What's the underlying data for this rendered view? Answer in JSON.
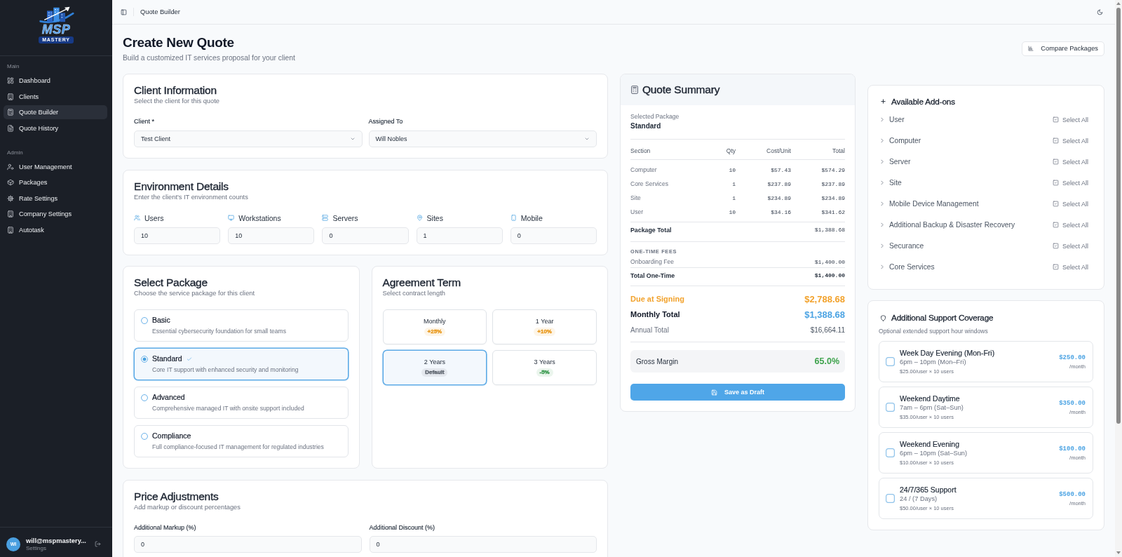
{
  "sidebar": {
    "logo": {
      "wordmark": "MSP",
      "tagline": "MASTERY"
    },
    "sections": [
      {
        "heading": "Main",
        "items": [
          {
            "label": "Dashboard",
            "selected": false
          },
          {
            "label": "Clients",
            "selected": false
          },
          {
            "label": "Quote Builder",
            "selected": true
          },
          {
            "label": "Quote History",
            "selected": false
          }
        ]
      },
      {
        "heading": "Admin",
        "items": [
          {
            "label": "User Management",
            "selected": false
          },
          {
            "label": "Packages",
            "selected": false
          },
          {
            "label": "Rate Settings",
            "selected": false
          },
          {
            "label": "Company Settings",
            "selected": false
          },
          {
            "label": "Autotask",
            "selected": false
          }
        ]
      }
    ],
    "user": {
      "initials": "WI",
      "email": "will@mspmastery...",
      "subtitle": "Settings"
    }
  },
  "top_bar": {
    "title": "Quote Builder"
  },
  "header": {
    "title": "Create New Quote",
    "subtitle": "Build a customized IT services proposal for your client",
    "compare_button": "Compare Packages"
  },
  "client_information": {
    "title": "Client Information",
    "subtitle": "Select the client for this quote",
    "fields": [
      {
        "label": "Client *",
        "value": "Test Client"
      },
      {
        "label": "Assigned To",
        "value": "Will Nobles"
      }
    ]
  },
  "environment_details": {
    "title": "Environment Details",
    "subtitle": "Enter the client's IT environment counts",
    "fields": [
      {
        "label": "Users",
        "value": "10"
      },
      {
        "label": "Workstations",
        "value": "10"
      },
      {
        "label": "Servers",
        "value": "0"
      },
      {
        "label": "Sites",
        "value": "1"
      },
      {
        "label": "Mobile",
        "value": "0"
      }
    ]
  },
  "select_package": {
    "title": "Select Package",
    "subtitle": "Choose the service package for this client",
    "options": [
      {
        "name": "Basic",
        "description": "Essential cybersecurity foundation for small teams",
        "selected": false
      },
      {
        "name": "Standard",
        "description": "Core IT support with enhanced security and monitoring",
        "selected": true
      },
      {
        "name": "Advanced",
        "description": "Comprehensive managed IT with onsite support included",
        "selected": false
      },
      {
        "name": "Compliance",
        "description": "Full compliance-focused IT management for regulated industries",
        "selected": false
      }
    ]
  },
  "agreement_term": {
    "title": "Agreement Term",
    "subtitle": "Select contract length",
    "options": [
      {
        "label": "Monthly",
        "badge": "+25%",
        "color": "#e99a1f",
        "selected": false
      },
      {
        "label": "1 Year",
        "badge": "+10%",
        "color": "#e99a1f",
        "selected": false
      },
      {
        "label": "2 Years",
        "badge": "Default",
        "color": "#5f6670",
        "selected": true
      },
      {
        "label": "3 Years",
        "badge": "-5%",
        "color": "#3a9a4f",
        "selected": false
      }
    ]
  },
  "price_adjustments": {
    "title": "Price Adjustments",
    "subtitle": "Add markup or discount percentages",
    "fields": [
      {
        "label": "Additional Markup (%)",
        "value": "0"
      },
      {
        "label": "Additional Discount (%)",
        "value": "0"
      }
    ]
  },
  "quote_summary": {
    "title": "Quote Summary",
    "selected_package_label": "Selected Package",
    "selected_package": "Standard",
    "columns": [
      "Section",
      "Qty",
      "Cost/Unit",
      "Total"
    ],
    "rows": [
      [
        "Computer",
        "10",
        "$57.43",
        "$574.29"
      ],
      [
        "Core Services",
        "1",
        "$237.89",
        "$237.89"
      ],
      [
        "Site",
        "1",
        "$234.89",
        "$234.89"
      ],
      [
        "User",
        "10",
        "$34.16",
        "$341.62"
      ]
    ],
    "package_total": {
      "label": "Package Total",
      "value": "$1,388.68"
    },
    "one_time_fees": {
      "heading": "ONE-TIME FEES",
      "items": [
        {
          "label": "Onboarding Fee",
          "value": "$1,400.00"
        }
      ],
      "total": {
        "label": "Total One-Time",
        "value": "$1,400.00"
      }
    },
    "totals": [
      {
        "kind": "due",
        "label": "Due at Signing",
        "value": "$2,788.68"
      },
      {
        "kind": "monthly",
        "label": "Monthly Total",
        "value": "$1,388.68"
      },
      {
        "kind": "annual",
        "label": "Annual Total",
        "value": "$16,664.11"
      }
    ],
    "gross_margin": {
      "label": "Gross Margin",
      "value": "65.0%"
    },
    "save_button": "Save as Draft"
  },
  "addons": {
    "title": "Available Add-ons",
    "categories": [
      {
        "name": "User",
        "expanded": false,
        "action": "Select All"
      },
      {
        "name": "Computer",
        "expanded": false,
        "action": "Select All"
      },
      {
        "name": "Server",
        "expanded": false,
        "action": "Select All"
      },
      {
        "name": "Site",
        "expanded": false,
        "action": "Select All"
      },
      {
        "name": "Mobile Device Management",
        "expanded": false,
        "action": "Select All"
      },
      {
        "name": "Additional Backup & Disaster Recovery",
        "expanded": false,
        "action": "Select All"
      },
      {
        "name": "Securance",
        "expanded": false,
        "action": "Select All"
      },
      {
        "name": "Core Services",
        "expanded": false,
        "action": "Select All"
      }
    ]
  },
  "support_coverage": {
    "title": "Additional Support Coverage",
    "subtitle": "Optional extended support hour windows",
    "options": [
      {
        "name": "Week Day Evening (Mon-Fri)",
        "hours": "6pm – 10pm (Mon–Fri)",
        "rate": "$25.00/user × 10 users",
        "price": "$250.00",
        "period": "/month",
        "checked": false
      },
      {
        "name": "Weekend Daytime",
        "hours": "7am – 6pm (Sat–Sun)",
        "rate": "$35.00/user × 10 users",
        "price": "$350.00",
        "period": "/month",
        "checked": false
      },
      {
        "name": "Weekend Evening",
        "hours": "6pm – 10pm (Sat–Sun)",
        "rate": "$10.00/user × 10 users",
        "price": "$100.00",
        "period": "/month",
        "checked": false
      },
      {
        "name": "24/7/365 Support",
        "hours": "24 / (7 Days)",
        "rate": "$50.00/user × 10 users",
        "price": "$500.00",
        "period": "/month",
        "checked": false
      }
    ]
  }
}
